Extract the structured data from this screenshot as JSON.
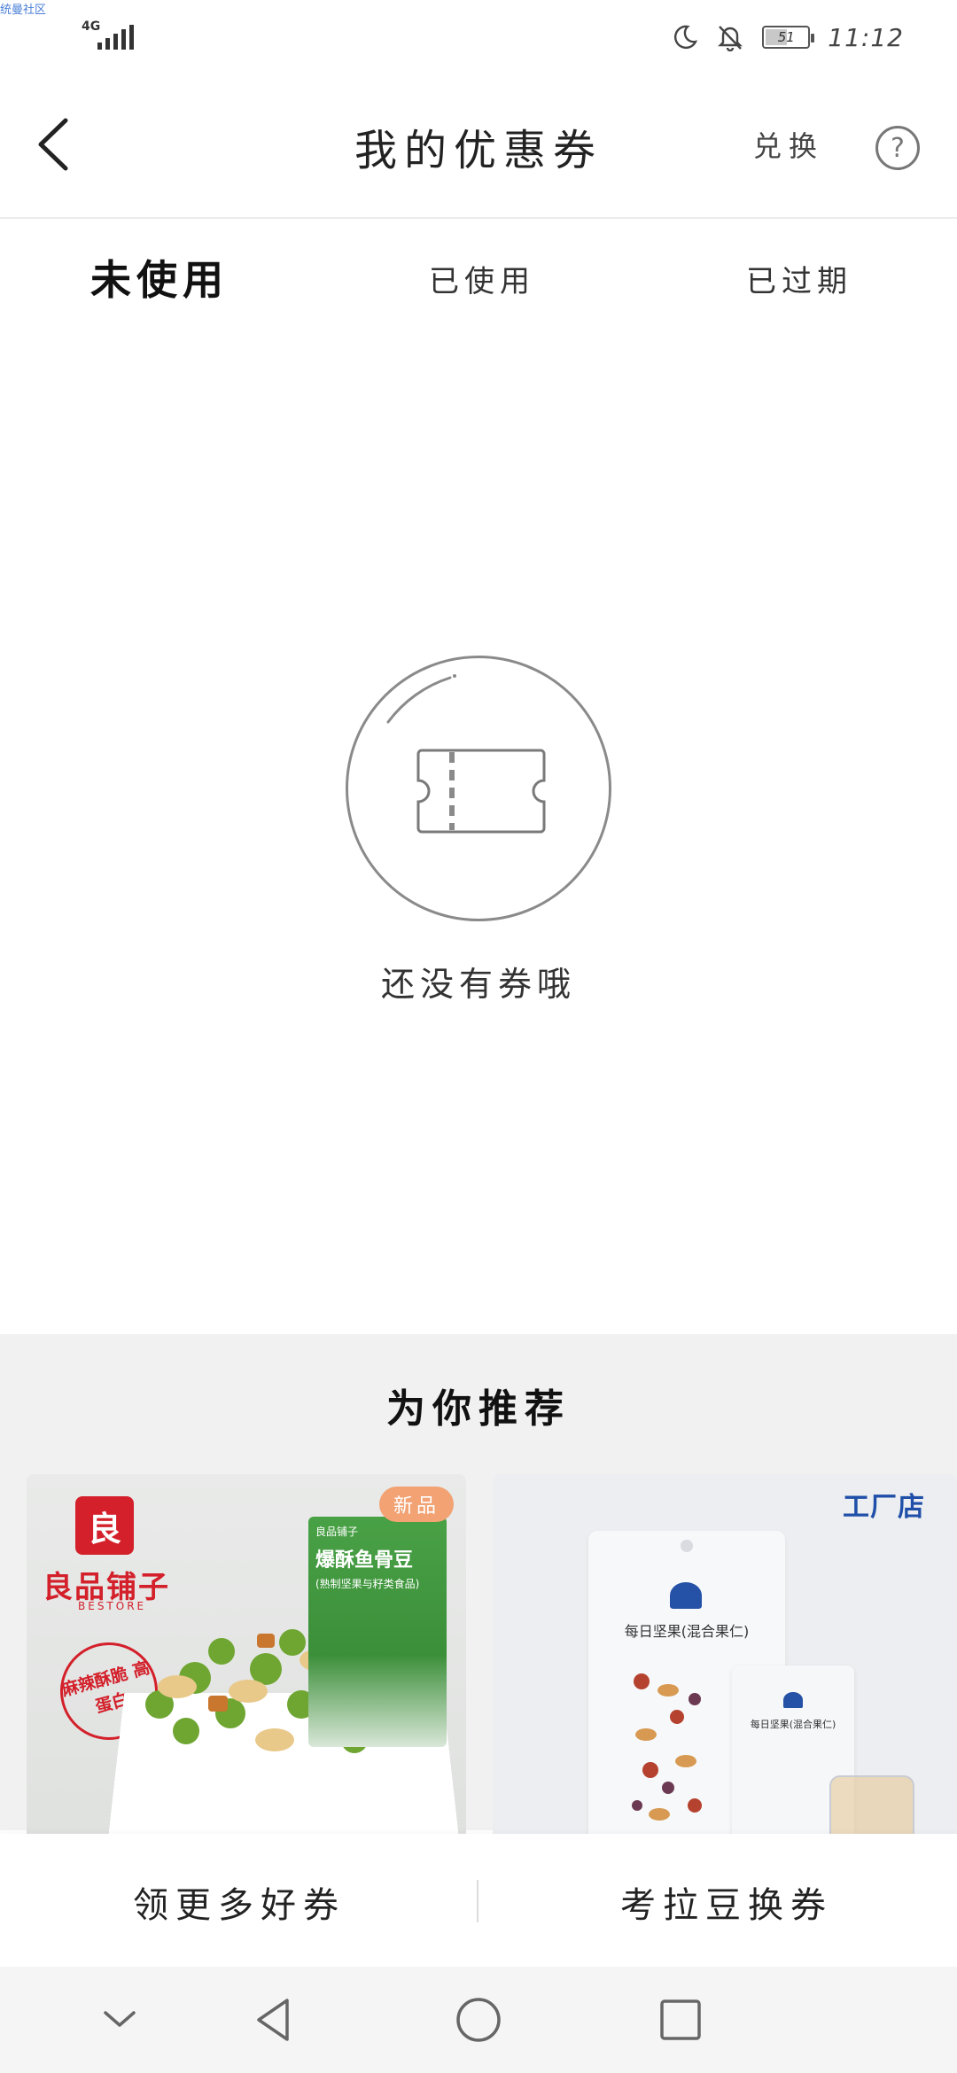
{
  "watermark": "统曼社区",
  "status_bar": {
    "network": "4G",
    "battery": "51",
    "time": "11:12"
  },
  "header": {
    "title": "我的优惠券",
    "exchange": "兑换",
    "help": "?"
  },
  "tabs": [
    {
      "label": "未使用",
      "active": true
    },
    {
      "label": "已使用",
      "active": false
    },
    {
      "label": "已过期",
      "active": false
    }
  ],
  "empty_state": {
    "text": "还没有券哦"
  },
  "recommend": {
    "title": "为你推荐",
    "products": [
      {
        "badge": "新品",
        "brand_icon": "良",
        "brand": "良品铺子",
        "brand_en": "BESTORE",
        "stamp": "麻辣酥脆 高蛋白",
        "package_brand": "良品铺子",
        "package_name": "爆酥鱼骨豆",
        "package_sub": "(熟制坚果与籽类食品)"
      },
      {
        "label": "工厂店",
        "package_name": "每日坚果(混合果仁)"
      }
    ]
  },
  "actions": {
    "more_coupons": "领更多好券",
    "exchange_beans": "考拉豆换券"
  },
  "colors": {
    "brand_red": "#d3202a",
    "badge_orange": "#f2a273",
    "factory_blue": "#1f4fa8",
    "package_green": "#49a146"
  }
}
